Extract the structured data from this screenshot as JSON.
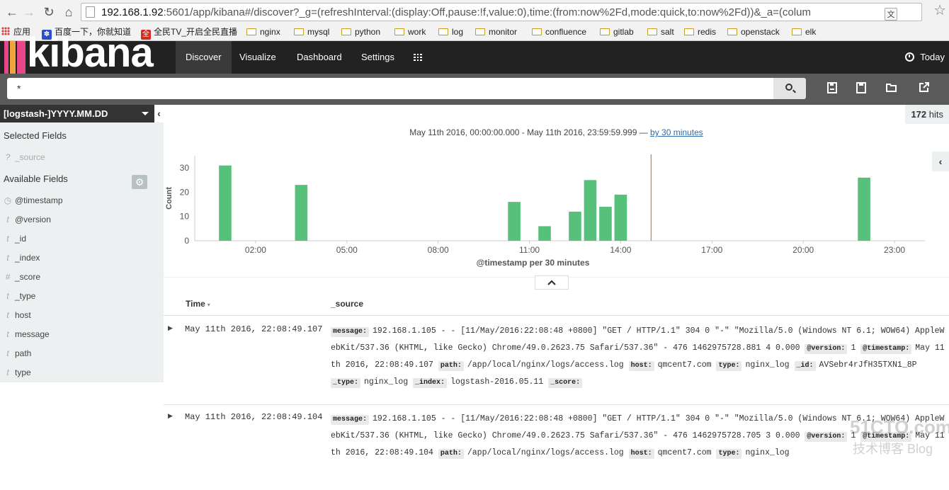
{
  "browser": {
    "url_host": "192.168.1.92",
    "url_rest": ":5601/app/kibana#/discover?_g=(refreshInterval:(display:Off,pause:!f,value:0),time:(from:now%2Fd,mode:quick,to:now%2Fd))&_a=(colum",
    "bookmarks": [
      "应用",
      "百度一下，你就知道",
      "全民TV_开启全民直播",
      "nginx",
      "mysql",
      "python",
      "work",
      "log",
      "monitor",
      "confluence",
      "gitlab",
      "salt",
      "redis",
      "openstack",
      "elk"
    ]
  },
  "nav": {
    "logo": "kibana",
    "tabs": [
      "Discover",
      "Visualize",
      "Dashboard",
      "Settings"
    ],
    "time_picker": "Today"
  },
  "search": {
    "query": "*"
  },
  "sidebar": {
    "index_pattern": "[logstash-]YYYY.MM.DD",
    "selected_title": "Selected Fields",
    "selected_fields": [
      {
        "type": "?",
        "name": "_source"
      }
    ],
    "available_title": "Available Fields",
    "available_fields": [
      {
        "type": "◷",
        "name": "@timestamp"
      },
      {
        "type": "t",
        "name": "@version"
      },
      {
        "type": "t",
        "name": "_id"
      },
      {
        "type": "t",
        "name": "_index"
      },
      {
        "type": "#",
        "name": "_score"
      },
      {
        "type": "t",
        "name": "_type"
      },
      {
        "type": "t",
        "name": "host"
      },
      {
        "type": "t",
        "name": "message"
      },
      {
        "type": "t",
        "name": "path"
      },
      {
        "type": "t",
        "name": "type"
      }
    ]
  },
  "main": {
    "hits_count": "172",
    "hits_label": "hits",
    "range_text": "May 11th 2016, 00:00:00.000 - May 11th 2016, 23:59:59.999 — ",
    "interval_link": "by 30 minutes",
    "columns": [
      "Time",
      "_source"
    ],
    "rows": [
      {
        "time": "May 11th 2016, 22:08:49.107",
        "fields": [
          {
            "k": "message:",
            "v": "192.168.1.105 - - [11/May/2016:22:08:48 +0800] \"GET / HTTP/1.1\" 304 0 \"-\" \"Mozilla/5.0 (Windows NT 6.1; WOW64) AppleWebKit/537.36 (KHTML, like Gecko) Chrome/49.0.2623.75 Safari/537.36\" - 476 1462975728.881 4 0.000"
          },
          {
            "k": "@version:",
            "v": "1"
          },
          {
            "k": "@timestamp:",
            "v": "May 11th 2016, 22:08:49.107"
          },
          {
            "k": "path:",
            "v": "/app/local/nginx/logs/access.log"
          },
          {
            "k": "host:",
            "v": "qmcent7.com"
          },
          {
            "k": "type:",
            "v": "nginx_log"
          },
          {
            "k": "_id:",
            "v": "AVSebr4rJfH35TXN1_8P"
          },
          {
            "k": "_type:",
            "v": "nginx_log"
          },
          {
            "k": "_index:",
            "v": "logstash-2016.05.11"
          },
          {
            "k": "_score:",
            "v": ""
          }
        ]
      },
      {
        "time": "May 11th 2016, 22:08:49.104",
        "fields": [
          {
            "k": "message:",
            "v": "192.168.1.105 - - [11/May/2016:22:08:48 +0800] \"GET / HTTP/1.1\" 304 0 \"-\" \"Mozilla/5.0 (Windows NT 6.1; WOW64) AppleWebKit/537.36 (KHTML, like Gecko) Chrome/49.0.2623.75 Safari/537.36\" - 476 1462975728.705 3 0.000"
          },
          {
            "k": "@version:",
            "v": "1"
          },
          {
            "k": "@timestamp:",
            "v": "May 11th 2016, 22:08:49.104"
          },
          {
            "k": "path:",
            "v": "/app/local/nginx/logs/access.log"
          },
          {
            "k": "host:",
            "v": "qmcent7.com"
          },
          {
            "k": "type:",
            "v": "nginx_log"
          }
        ]
      }
    ]
  },
  "chart_data": {
    "type": "bar",
    "ylabel": "Count",
    "xlabel": "@timestamp per 30 minutes",
    "ylim": [
      0,
      35
    ],
    "y_ticks": [
      0,
      10,
      20,
      30
    ],
    "x_ticks": [
      "02:00",
      "05:00",
      "08:00",
      "11:00",
      "14:00",
      "17:00",
      "20:00",
      "23:00"
    ],
    "x_tick_hours": [
      2,
      5,
      8,
      11,
      14,
      17,
      20,
      23
    ],
    "x_range_hours": [
      0,
      24
    ],
    "now_marker_hour": 15,
    "bar_color": "#57c17b",
    "marker_color": "#e0773a",
    "bars": [
      {
        "hour": 1.0,
        "count": 31
      },
      {
        "hour": 3.5,
        "count": 23
      },
      {
        "hour": 10.5,
        "count": 16
      },
      {
        "hour": 11.5,
        "count": 6
      },
      {
        "hour": 12.5,
        "count": 12
      },
      {
        "hour": 13.0,
        "count": 25
      },
      {
        "hour": 13.5,
        "count": 14
      },
      {
        "hour": 14.0,
        "count": 19
      },
      {
        "hour": 22.0,
        "count": 26
      }
    ]
  },
  "watermark": {
    "line1": "51CTO.com",
    "line2": "技术博客 Blog"
  }
}
